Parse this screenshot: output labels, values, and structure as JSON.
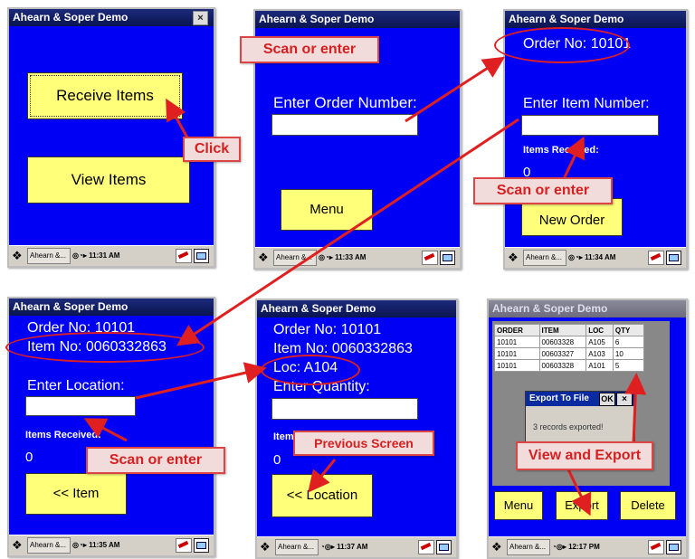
{
  "app_title": "Ahearn & Soper Demo",
  "screen1": {
    "receive_button": "Receive Items",
    "view_button": "View Items",
    "close_label": "×",
    "time": "11:31 AM"
  },
  "screen2": {
    "prompt": "Enter Order Number:",
    "menu_button": "Menu",
    "time": "11:33 AM"
  },
  "screen3": {
    "order_no": "Order No: 10101",
    "prompt": "Enter Item Number:",
    "items_received_label": "Items Received:",
    "items_received_value": "0",
    "new_order_button": "New Order",
    "time": "11:34 AM"
  },
  "screen4": {
    "order_no": "Order No: 10101",
    "item_no": "Item No: 0060332863",
    "prompt": "Enter Location:",
    "items_received_label": "Items Received:",
    "items_received_value": "0",
    "back_button": "<< Item",
    "time": "11:35 AM"
  },
  "screen5": {
    "order_no": "Order No: 10101",
    "item_no": "Item No: 0060332863",
    "loc": "Loc: A104",
    "prompt": "Enter Quantity:",
    "items_received_label": "Items R",
    "items_received_value": "0",
    "back_button": "<< Location",
    "time": "11:37 AM"
  },
  "screen6": {
    "columns": [
      "ORDER",
      "ITEM",
      "LOC",
      "QTY"
    ],
    "rows": [
      [
        "10101",
        "00603328",
        "A105",
        "6"
      ],
      [
        "10101",
        "00603327",
        "A103",
        "10"
      ],
      [
        "10101",
        "00603328",
        "A101",
        "5"
      ]
    ],
    "dialog_title": "Export To File",
    "dialog_ok": "OK",
    "dialog_close": "×",
    "dialog_message": "3 records exported!",
    "menu_button": "Menu",
    "export_button": "Export",
    "delete_button": "Delete",
    "time": "12:17 PM"
  },
  "taskbar": {
    "app_label": "Ahearn &..."
  },
  "callouts": {
    "click": "Click",
    "scan_or_enter": "Scan or enter",
    "previous_screen": "Previous Screen",
    "view_and_export": "View and Export"
  },
  "colors": {
    "screen_bg": "#0000f5",
    "button_bg": "#ffff7a",
    "callout_text": "#d42020",
    "callout_bg": "#f2dcdb"
  }
}
